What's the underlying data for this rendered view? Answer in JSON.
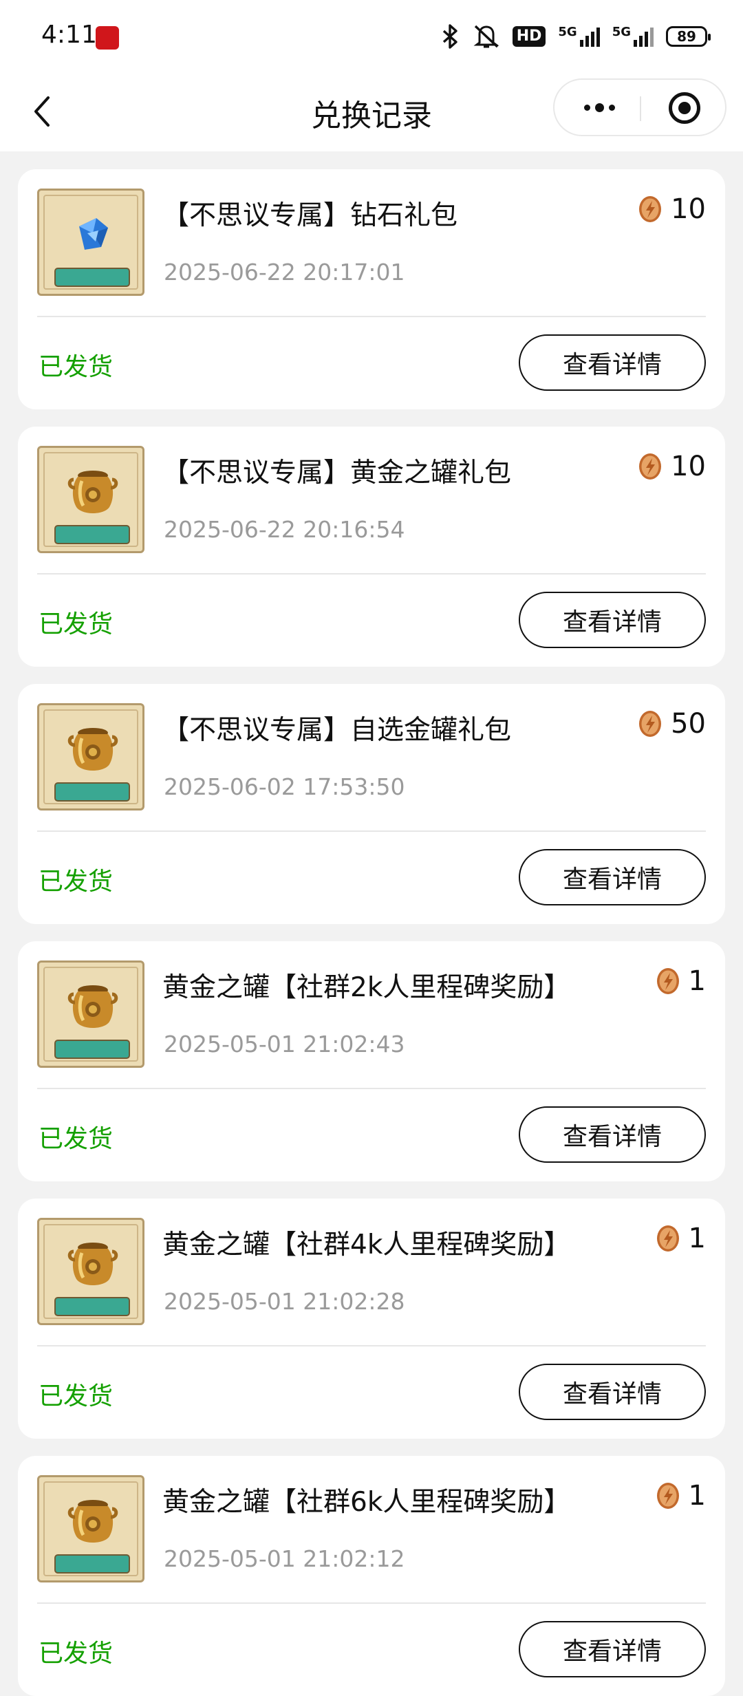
{
  "status_bar": {
    "time": "4:11",
    "hd_label": "HD",
    "net1": "5G",
    "net2": "5G",
    "battery": "89"
  },
  "nav": {
    "title": "兑换记录"
  },
  "detail_label": "查看详情",
  "records": [
    {
      "title": "【不思议专属】钻石礼包",
      "date": "2025-06-22 20:17:01",
      "price": "10",
      "status": "已发货",
      "icon": "diamond-icon"
    },
    {
      "title": "【不思议专属】黄金之罐礼包",
      "date": "2025-06-22 20:16:54",
      "price": "10",
      "status": "已发货",
      "icon": "golden-jar-icon"
    },
    {
      "title": "【不思议专属】自选金罐礼包",
      "date": "2025-06-02 17:53:50",
      "price": "50",
      "status": "已发货",
      "icon": "golden-jar-icon"
    },
    {
      "title": "黄金之罐【社群2k人里程碑奖励】",
      "date": "2025-05-01 21:02:43",
      "price": "1",
      "status": "已发货",
      "icon": "golden-jar-icon"
    },
    {
      "title": "黄金之罐【社群4k人里程碑奖励】",
      "date": "2025-05-01 21:02:28",
      "price": "1",
      "status": "已发货",
      "icon": "golden-jar-icon"
    },
    {
      "title": "黄金之罐【社群6k人里程碑奖励】",
      "date": "2025-05-01 21:02:12",
      "price": "1",
      "status": "已发货",
      "icon": "golden-jar-icon"
    }
  ],
  "colors": {
    "status_green": "#14a000",
    "date_gray": "#9a9a9a",
    "background": "#f2f2f2"
  }
}
